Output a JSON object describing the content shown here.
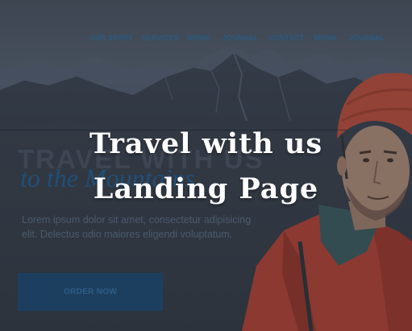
{
  "nav": {
    "items": [
      "OUR STORY",
      "SERVICES",
      "WORK",
      "JOURNAL",
      "CONTACT",
      "WORK",
      "JOURNAL"
    ]
  },
  "hero": {
    "heading": "TRAVEL WITH US",
    "subheading": "to the Mountains",
    "body": "Lorem ipsum dolor sit amet, consectetur adipisicing elit. Delectus odio maiores eligendi voluptatum.",
    "button_label": "ORDER NOW"
  },
  "overlay_title": {
    "line1": "Travel with us",
    "line2": "Landing Page"
  },
  "colors": {
    "nav_text": "#2c5a82",
    "button_bg": "#1d3f5f",
    "jacket": "#c8412f",
    "helmet": "#d44f38",
    "title": "#ffffff"
  }
}
